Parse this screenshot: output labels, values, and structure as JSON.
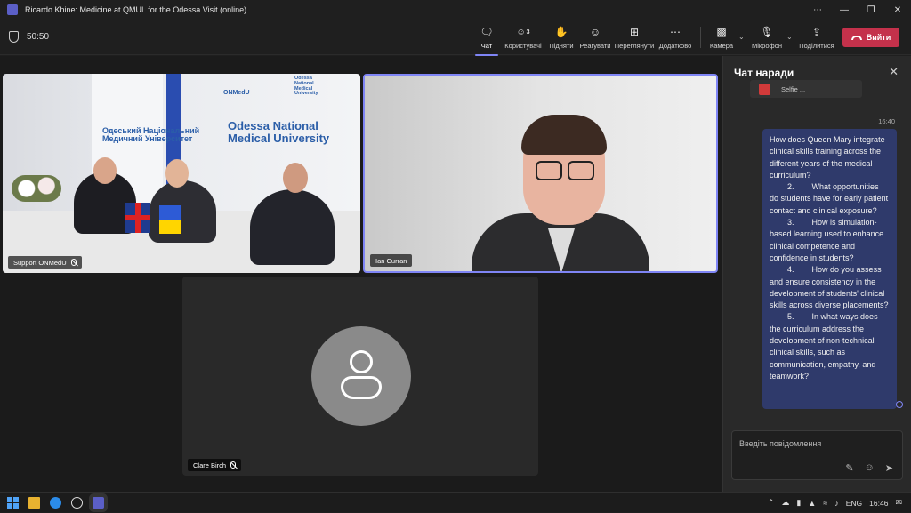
{
  "window": {
    "title": "Ricardo Khine: Medicine at QMUL for the Odessa Visit (online)",
    "controls": [
      "⋯",
      "—",
      "❐",
      "✕"
    ]
  },
  "toolbar": {
    "timer": "50:50",
    "buttons": [
      {
        "id": "chat",
        "label": "Чат",
        "icon": "chat-icon",
        "glyph": "💬"
      },
      {
        "id": "people",
        "label": "Користувачі",
        "icon": "people-icon",
        "glyph": "👥",
        "count": "3"
      },
      {
        "id": "raise",
        "label": "Підняти",
        "icon": "raise-hand-icon",
        "glyph": "✋"
      },
      {
        "id": "react",
        "label": "Реагувати",
        "icon": "emoji-icon",
        "glyph": "☺"
      },
      {
        "id": "view",
        "label": "Переглянути",
        "icon": "grid-view-icon",
        "glyph": "⊞"
      },
      {
        "id": "more",
        "label": "Додатково",
        "icon": "more-icon",
        "glyph": "⋯"
      },
      {
        "id": "camera",
        "label": "Камера",
        "icon": "camera-icon",
        "glyph": "▶"
      },
      {
        "id": "mic",
        "label": "Мікрофон",
        "icon": "microphone-off-icon",
        "glyph": "🎤"
      },
      {
        "id": "share",
        "label": "Поділитися",
        "icon": "share-icon",
        "glyph": "⇪"
      }
    ],
    "leave_label": "Вийти"
  },
  "participants": [
    {
      "name": "Support ONMedU",
      "muted": true
    },
    {
      "name": "Ian Curran",
      "muted": false
    },
    {
      "name": "Clare Birch",
      "muted": true
    }
  ],
  "support_tile": {
    "banner_left_lines": [
      "Одеський Національний",
      "Медичний Університет"
    ],
    "banner_right_lines": [
      "Odessa National",
      "Medical University"
    ],
    "small_banner": "ONMedU",
    "small_banner_2": "Odessa National Medical University"
  },
  "chat": {
    "header": "Чат наради",
    "previous_attachment": "Selfie ...",
    "message_time": "16:40",
    "message": "How does Queen Mary integrate clinical skills training across the different years of the medical curriculum?\n        2.        What opportunities do students have for early patient contact and clinical exposure?\n        3.        How is simulation-based learning used to enhance clinical competence and confidence in students?\n        4.        How do you assess and ensure consistency in the development of students' clinical skills across diverse placements?\n        5.        In what ways does the curriculum address the development of non-technical clinical skills, such as communication, empathy, and teamwork?",
    "compose_placeholder": "Введіть повідомлення"
  },
  "taskbar": {
    "language": "ENG",
    "clock": "16:46",
    "accent": "#4fa3f7"
  },
  "colors": {
    "accent": "#7f85f5",
    "leave": "#c4314b",
    "bubble": "#2f3a6b"
  }
}
